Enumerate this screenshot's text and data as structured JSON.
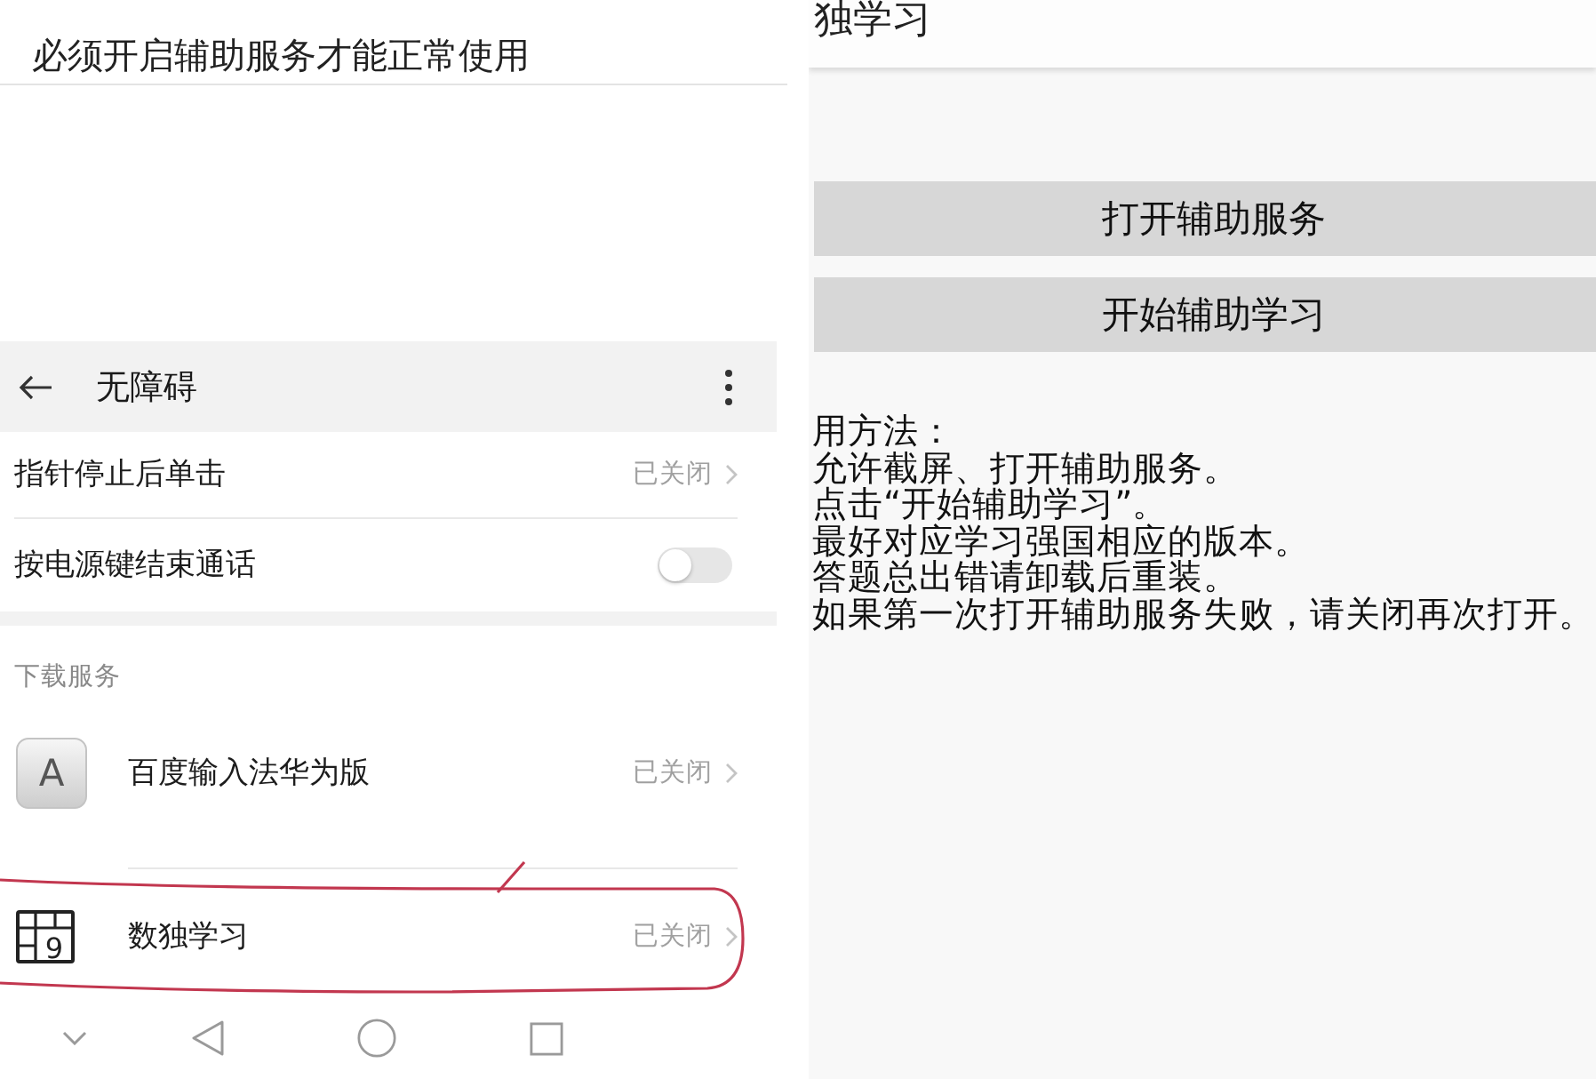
{
  "left_screen": {
    "banner": "必须开启辅助服务才能正常使用",
    "toolbar": {
      "title": "无障碍"
    },
    "settings": [
      {
        "kind": "link",
        "label": "指针停止后单击",
        "value": "已关闭"
      },
      {
        "kind": "switch",
        "label": "按电源键结束通话",
        "on": false
      }
    ],
    "section_header": "下载服务",
    "services": [
      {
        "kind": "letter",
        "icon_text": "A",
        "label": "百度输入法华为版",
        "value": "已关闭",
        "highlighted": false
      },
      {
        "kind": "grid",
        "icon_text": "9",
        "label": "数独学习",
        "value": "已关闭",
        "highlighted": true
      }
    ]
  },
  "right_screen": {
    "title": "独学习",
    "buttons": [
      "打开辅助服务",
      "开始辅助学习"
    ],
    "instructions": {
      "heading": "用方法：",
      "lines": [
        "允许截屏、打开辅助服务。",
        "点击“开始辅助学习”。",
        "最好对应学习强国相应的版本。",
        "答题总出错请卸载后重装。",
        "如果第一次打开辅助服务失败，请关闭再次打开。"
      ]
    }
  }
}
